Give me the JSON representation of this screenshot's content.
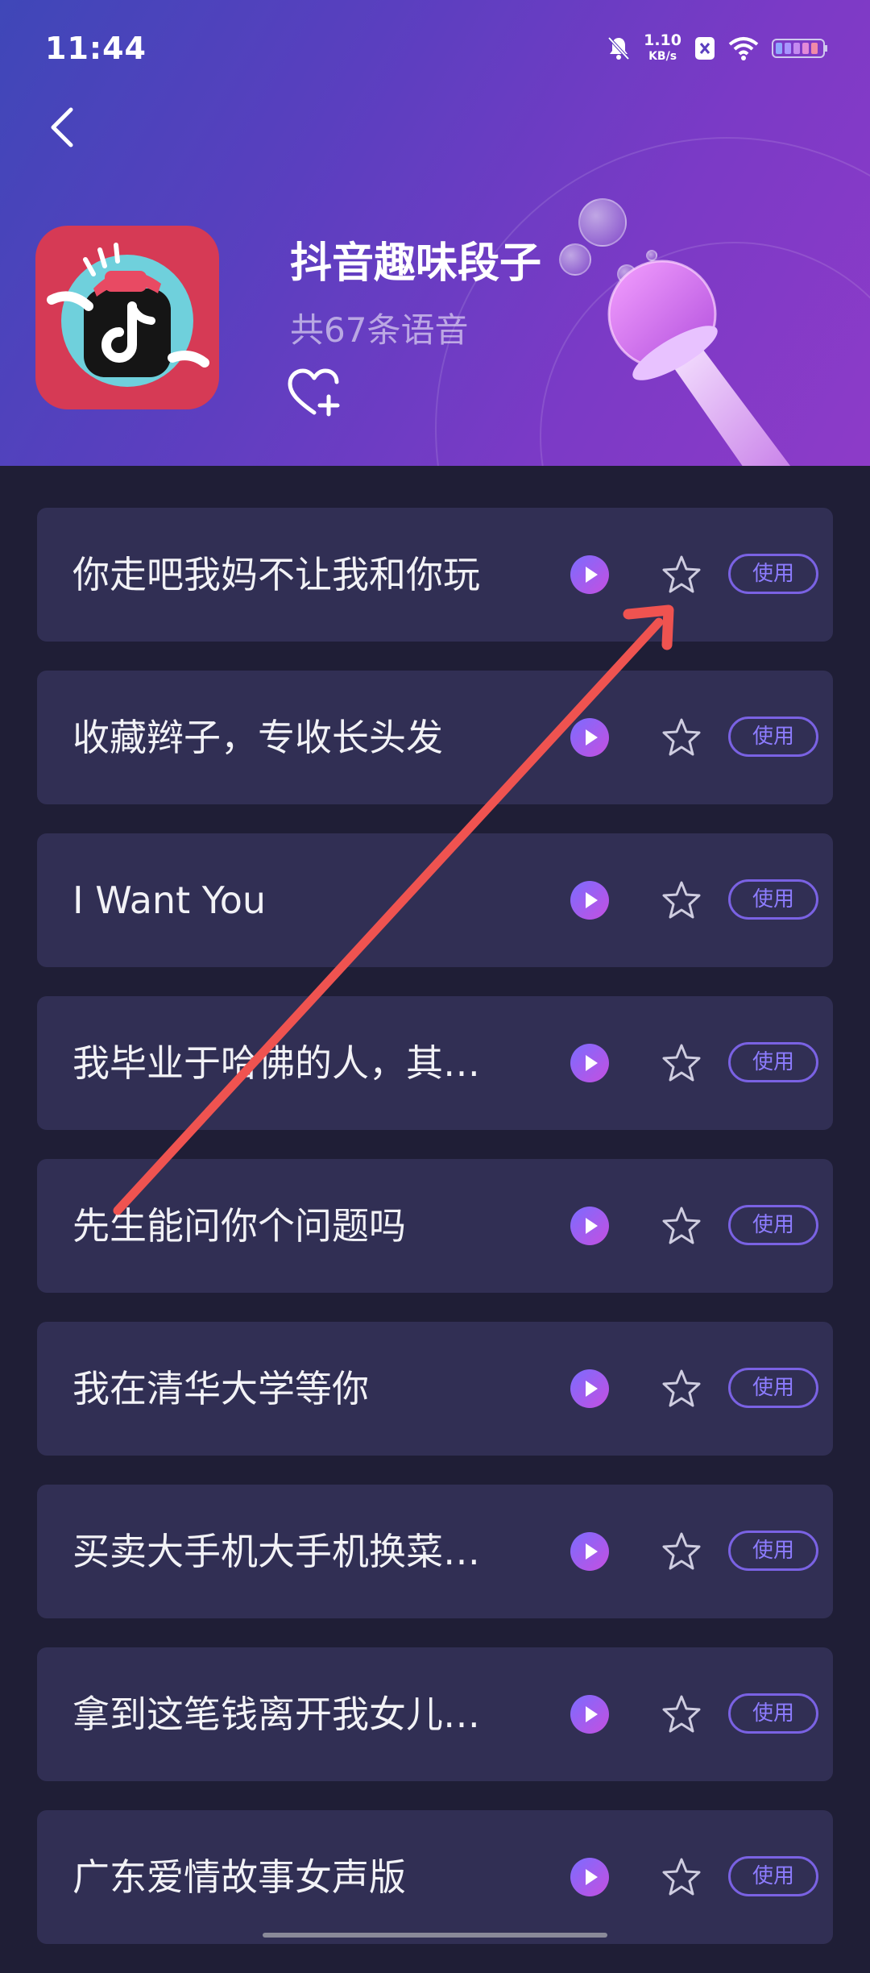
{
  "status_bar": {
    "time": "11:44",
    "net_speed_value": "1.10",
    "net_speed_unit": "KB/s"
  },
  "header": {
    "title": "抖音趣味段子",
    "subtitle": "共67条语音"
  },
  "items": [
    {
      "label": "你走吧我妈不让我和你玩",
      "use": "使用"
    },
    {
      "label": "收藏辫子，专收长头发",
      "use": "使用"
    },
    {
      "label": "I Want You",
      "use": "使用"
    },
    {
      "label": "我毕业于哈佛的人，其…",
      "use": "使用"
    },
    {
      "label": "先生能问你个问题吗",
      "use": "使用"
    },
    {
      "label": "我在清华大学等你",
      "use": "使用"
    },
    {
      "label": "买卖大手机大手机换菜…",
      "use": "使用"
    },
    {
      "label": "拿到这笔钱离开我女儿…",
      "use": "使用"
    },
    {
      "label": "广东爱情故事女声版",
      "use": "使用"
    }
  ],
  "colors": {
    "accent": "#7a62e3",
    "arrow": "#ef5350",
    "row_bg": "#312f54"
  },
  "icons": [
    "back-arrow-icon",
    "heart-plus-icon",
    "play-icon",
    "star-icon",
    "mute-bell-icon",
    "wifi-icon",
    "battery-icon"
  ]
}
